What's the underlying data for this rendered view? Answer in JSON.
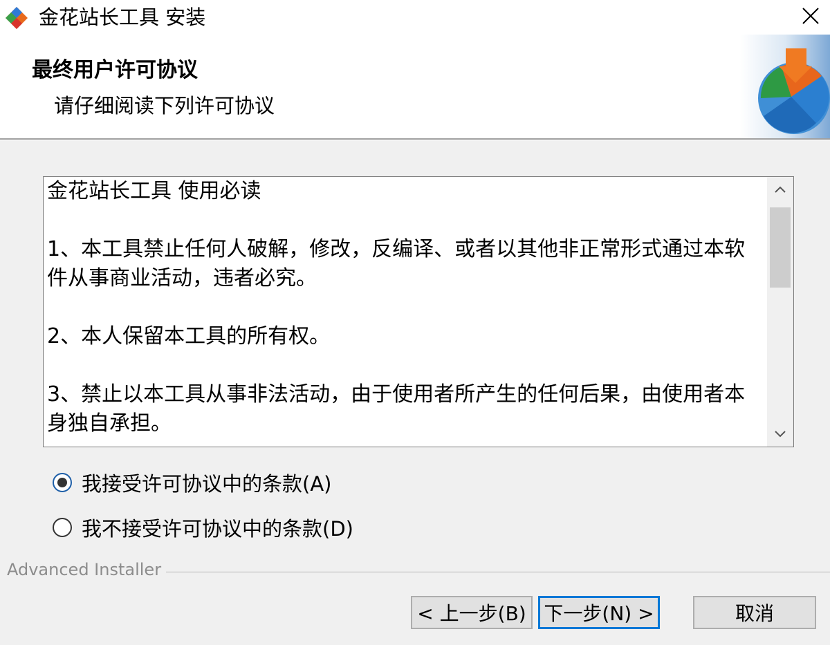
{
  "window": {
    "title": "金花站长工具 安装",
    "close_icon": "close-icon"
  },
  "header": {
    "title": "最终用户许可协议",
    "subtitle": "请仔细阅读下列许可协议",
    "logo_icon": "installer-puzzle-logo-icon"
  },
  "license": {
    "heading": "金花站长工具  使用必读",
    "para1": "1、本工具禁止任何人破解，修改，反编译、或者以其他非正常形式通过本软件从事商业活动，违者必究。",
    "para2": "2、本人保留本工具的所有权。",
    "para3": "3、禁止以本工具从事非法活动，由于使用者所产生的任何后果，由使用者本身独自承担。"
  },
  "options": {
    "accept": "我接受许可协议中的条款(A)",
    "decline": "我不接受许可协议中的条款(D)",
    "selected": "accept"
  },
  "footer": {
    "brand": "Advanced Installer"
  },
  "buttons": {
    "back": "< 上一步(B)",
    "next": "下一步(N) >",
    "cancel": "取消"
  }
}
